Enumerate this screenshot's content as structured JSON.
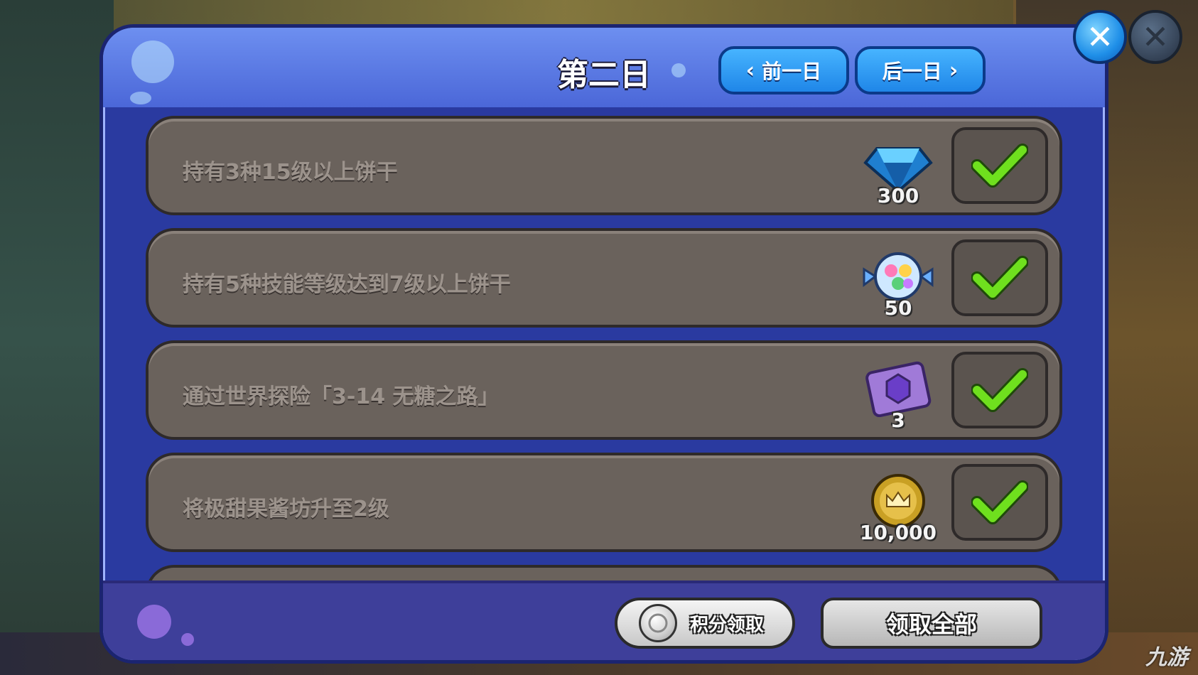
{
  "header": {
    "title": "第二日",
    "prev_label": "前一日",
    "next_label": "后一日"
  },
  "tasks": [
    {
      "text": "持有3种15级以上饼干",
      "reward_icon": "diamond-icon",
      "reward_amount": "300",
      "completed": true
    },
    {
      "text": "持有5种技能等级达到7级以上饼干",
      "reward_icon": "candy-icon",
      "reward_amount": "50",
      "completed": true
    },
    {
      "text": "通过世界探险「3-14 无糖之路」",
      "reward_icon": "skill-book-icon",
      "reward_amount": "3",
      "completed": true
    },
    {
      "text": "将极甜果酱坊升至2级",
      "reward_icon": "gold-coin-icon",
      "reward_amount": "10,000",
      "completed": true
    }
  ],
  "footer": {
    "points_label": "积分领取",
    "claim_all_label": "领取全部"
  },
  "watermark": "九游",
  "colors": {
    "nav_button": "#1f86e8",
    "check_green": "#6fe01e",
    "panel": "#2a3aa0"
  }
}
